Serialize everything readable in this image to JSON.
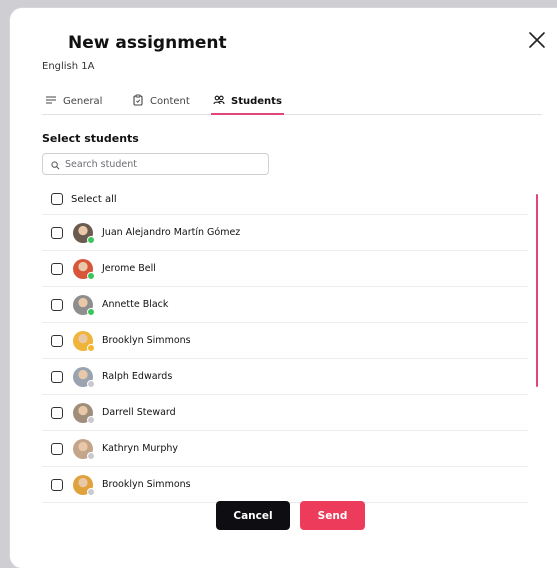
{
  "dialog": {
    "title": "New assignment",
    "subtitle": "English 1A"
  },
  "tabs": [
    {
      "label": "General",
      "icon": "menu-lines-icon",
      "active": false
    },
    {
      "label": "Content",
      "icon": "clipboard-icon",
      "active": false
    },
    {
      "label": "Students",
      "icon": "users-icon",
      "active": true
    }
  ],
  "section_title": "Select students",
  "search": {
    "placeholder": "Search student",
    "value": ""
  },
  "select_all_label": "Select all",
  "students": [
    {
      "name": "Juan Alejandro Martín Gómez",
      "checked": false,
      "status": "online",
      "avatar_color": "#6b5a4e"
    },
    {
      "name": "Jerome Bell",
      "checked": false,
      "status": "online",
      "avatar_color": "#d9553a"
    },
    {
      "name": "Annette Black",
      "checked": false,
      "status": "online",
      "avatar_color": "#8e8e8e"
    },
    {
      "name": "Brooklyn Simmons",
      "checked": false,
      "status": "away",
      "avatar_color": "#f0b43a"
    },
    {
      "name": "Ralph Edwards",
      "checked": false,
      "status": "offline",
      "avatar_color": "#9aa4b0"
    },
    {
      "name": "Darrell Steward",
      "checked": false,
      "status": "offline",
      "avatar_color": "#a08e7a"
    },
    {
      "name": "Kathryn Murphy",
      "checked": false,
      "status": "offline",
      "avatar_color": "#c4a58a"
    },
    {
      "name": "Brooklyn Simmons",
      "checked": false,
      "status": "offline",
      "avatar_color": "#e0a23c"
    }
  ],
  "colors": {
    "accent": "#e0467a",
    "send_button": "#ec3b5b",
    "cancel_button": "#0e0e12",
    "status_online": "#3cc45a",
    "status_away": "#f2b72e",
    "status_offline": "#c9c9cf"
  },
  "buttons": {
    "cancel_label": "Cancel",
    "send_label": "Send"
  }
}
